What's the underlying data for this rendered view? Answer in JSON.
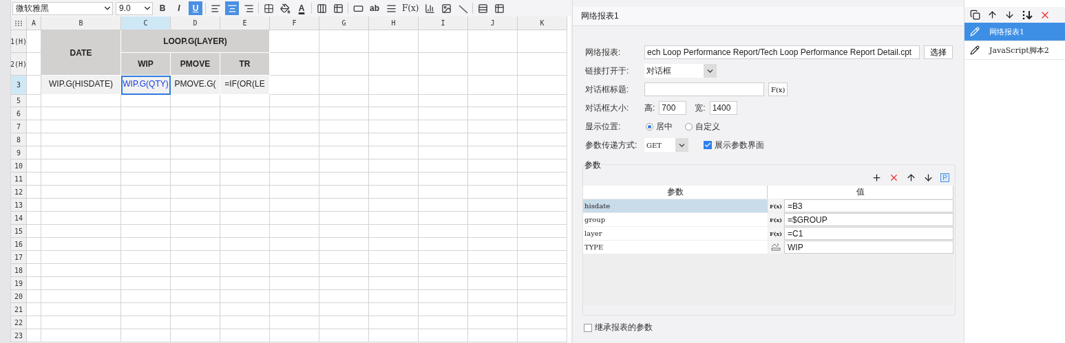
{
  "toolbar": {
    "font": "微软雅黑",
    "size": "9.0",
    "styles": [
      {
        "label": "B",
        "selected": false
      },
      {
        "label": "I",
        "selected": false
      },
      {
        "label": "U",
        "selected": true
      }
    ],
    "aligns": [
      {
        "selected": false
      },
      {
        "selected": true
      },
      {
        "selected": false
      }
    ],
    "font_color": "A",
    "text_tool": "ab",
    "formula_tool": "F(x)"
  },
  "sheet": {
    "columns": [
      {
        "label": "A",
        "selected": false
      },
      {
        "label": "B",
        "selected": false
      },
      {
        "label": "C",
        "selected": true
      },
      {
        "label": "D",
        "selected": false
      },
      {
        "label": "E",
        "selected": false
      },
      {
        "label": "F",
        "selected": false
      },
      {
        "label": "G",
        "selected": false
      },
      {
        "label": "H",
        "selected": false
      },
      {
        "label": "I",
        "selected": false
      },
      {
        "label": "J",
        "selected": false
      },
      {
        "label": "K",
        "selected": false
      }
    ],
    "rows": [
      {
        "label": "1(H)",
        "selected": false
      },
      {
        "label": "2(H)",
        "selected": false
      },
      {
        "label": "3",
        "selected": true
      },
      {
        "label": "5",
        "selected": false
      },
      {
        "label": "6",
        "selected": false
      },
      {
        "label": "7",
        "selected": false
      },
      {
        "label": "8",
        "selected": false
      },
      {
        "label": "9",
        "selected": false
      },
      {
        "label": "10",
        "selected": false
      },
      {
        "label": "11",
        "selected": false
      },
      {
        "label": "12",
        "selected": false
      },
      {
        "label": "13",
        "selected": false
      },
      {
        "label": "14",
        "selected": false
      },
      {
        "label": "15",
        "selected": false
      },
      {
        "label": "16",
        "selected": false
      },
      {
        "label": "17",
        "selected": false
      },
      {
        "label": "18",
        "selected": false
      },
      {
        "label": "19",
        "selected": false
      },
      {
        "label": "20",
        "selected": false
      },
      {
        "label": "21",
        "selected": false
      },
      {
        "label": "22",
        "selected": false
      },
      {
        "label": "23",
        "selected": false
      }
    ],
    "cells": [
      {
        "text": "DATE",
        "kind": "header",
        "selected": false
      },
      {
        "text": "LOOP.G(LAYER)",
        "kind": "header",
        "selected": false
      },
      {
        "text": "WIP",
        "kind": "header",
        "selected": false
      },
      {
        "text": "PMOVE",
        "kind": "header",
        "selected": false
      },
      {
        "text": "TR",
        "kind": "header",
        "selected": false
      },
      {
        "text": "WIP.G(HISDATE)",
        "kind": "data",
        "selected": false
      },
      {
        "text": "WIP.G(QTY)",
        "kind": "data",
        "selected": true
      },
      {
        "text": "PMOVE.G(",
        "kind": "data",
        "selected": false
      },
      {
        "text": "=IF(OR(LE",
        "kind": "data",
        "selected": false
      }
    ]
  },
  "editor": {
    "title": "网络报表1",
    "report_label": "网络报表:",
    "report_value": "ech Loop Performance Report/Tech Loop Performance Report Detail.cpt",
    "choose_button": "选择",
    "open_label": "链接打开于:",
    "open_value": "对话框",
    "dialog_title_label": "对话框标题:",
    "formula_button": "F(x)",
    "size_label": "对话框大小:",
    "height_label": "高:",
    "height_value": "700",
    "width_label": "宽:",
    "width_value": "1400",
    "position_label": "显示位置:",
    "positions": [
      {
        "label": "居中",
        "selected": true
      },
      {
        "label": "自定义",
        "selected": false
      }
    ],
    "method_label": "参数传递方式:",
    "method_value": "GET",
    "show_params": {
      "label": "展示参数界面",
      "checked": true
    },
    "params_title": "参数",
    "param_toolbar_text": "P",
    "param_columns": [
      "参数",
      "值"
    ],
    "params": [
      {
        "name": "hisdate",
        "kind": "formula",
        "type_label": "F(x)",
        "value": "=B3",
        "selected": true
      },
      {
        "name": "group",
        "kind": "formula",
        "type_label": "F(x)",
        "value": "=$GROUP",
        "selected": false
      },
      {
        "name": "layer",
        "kind": "formula",
        "type_label": "F(x)",
        "value": "=C1",
        "selected": false
      },
      {
        "name": "TYPE",
        "kind": "text",
        "value": "WIP",
        "selected": false
      }
    ],
    "inherit": {
      "label": "继承报表的参数",
      "checked": false
    }
  },
  "links": [
    {
      "label": "网络报表1",
      "selected": true
    },
    {
      "label": "JavaScript脚本2",
      "selected": false
    }
  ]
}
